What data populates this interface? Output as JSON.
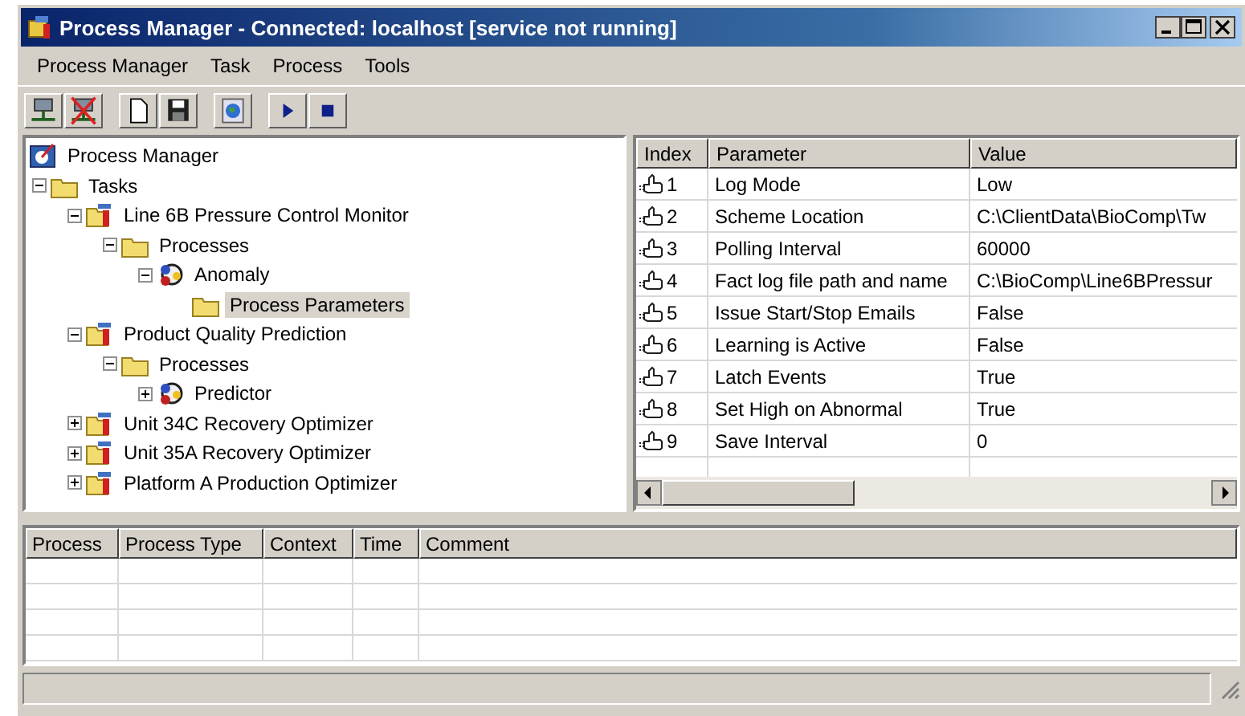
{
  "window": {
    "title": "Process Manager - Connected: localhost [service not running]"
  },
  "menu": [
    "Process Manager",
    "Task",
    "Process",
    "Tools"
  ],
  "tree": [
    {
      "label": "Process Manager",
      "kind": "root",
      "selected": false,
      "children": [
        {
          "label": "Tasks",
          "kind": "folder",
          "expanded": true,
          "selected": false,
          "children": [
            {
              "label": "Line 6B Pressure Control Monitor",
              "kind": "task",
              "expanded": true,
              "selected": false,
              "children": [
                {
                  "label": "Processes",
                  "kind": "folder",
                  "expanded": true,
                  "selected": false,
                  "children": [
                    {
                      "label": "Anomaly",
                      "kind": "process",
                      "expanded": true,
                      "selected": false,
                      "children": [
                        {
                          "label": "Process Parameters",
                          "kind": "folder",
                          "selected": true
                        }
                      ]
                    }
                  ]
                }
              ]
            },
            {
              "label": "Product Quality Prediction",
              "kind": "task",
              "expanded": true,
              "selected": false,
              "children": [
                {
                  "label": "Processes",
                  "kind": "folder",
                  "expanded": true,
                  "selected": false,
                  "children": [
                    {
                      "label": "Predictor",
                      "kind": "process",
                      "expanded": false,
                      "selected": false
                    }
                  ]
                }
              ]
            },
            {
              "label": "Unit 34C Recovery Optimizer",
              "kind": "task",
              "expanded": false,
              "selected": false
            },
            {
              "label": "Unit 35A Recovery Optimizer",
              "kind": "task",
              "expanded": false,
              "selected": false
            },
            {
              "label": "Platform A Production Optimizer",
              "kind": "task",
              "expanded": false,
              "selected": false
            }
          ]
        }
      ]
    }
  ],
  "parameters": {
    "columns": [
      "Index",
      "Parameter",
      "Value"
    ],
    "rows": [
      {
        "index": "1",
        "parameter": "Log Mode",
        "value": "Low"
      },
      {
        "index": "2",
        "parameter": "Scheme Location",
        "value": "C:\\ClientData\\BioComp\\Tw"
      },
      {
        "index": "3",
        "parameter": "Polling Interval",
        "value": "60000"
      },
      {
        "index": "4",
        "parameter": "Fact log file path and name",
        "value": "C:\\BioComp\\Line6BPressur"
      },
      {
        "index": "5",
        "parameter": "Issue Start/Stop Emails",
        "value": "False"
      },
      {
        "index": "6",
        "parameter": "Learning is Active",
        "value": "False"
      },
      {
        "index": "7",
        "parameter": "Latch Events",
        "value": "True"
      },
      {
        "index": "8",
        "parameter": "Set High on Abnormal",
        "value": "True"
      },
      {
        "index": "9",
        "parameter": "Save Interval",
        "value": "0"
      }
    ]
  },
  "events": {
    "columns": [
      "Process",
      "Process Type",
      "Context",
      "Time",
      "Comment"
    ]
  }
}
